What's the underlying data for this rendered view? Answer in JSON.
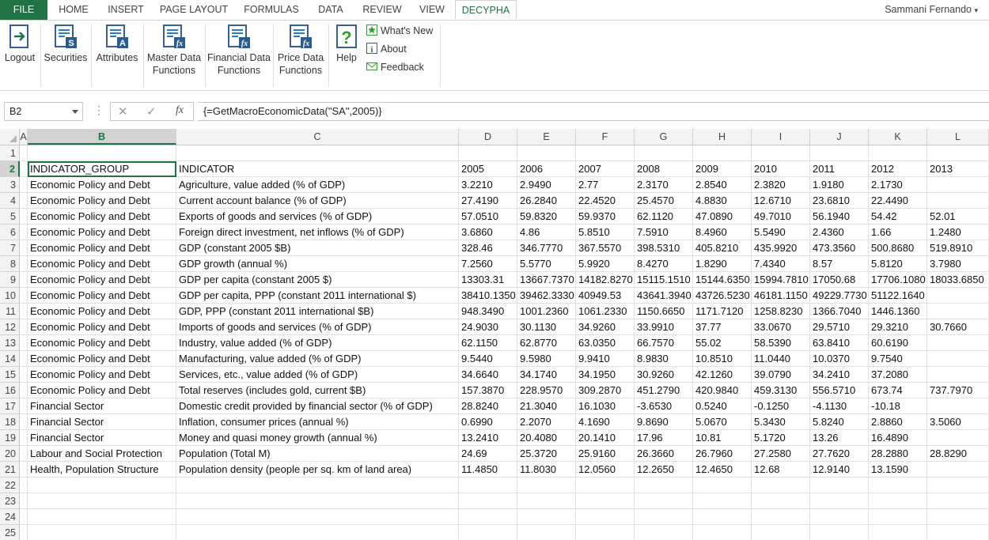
{
  "tabs": [
    "FILE",
    "HOME",
    "INSERT",
    "PAGE LAYOUT",
    "FORMULAS",
    "DATA",
    "REVIEW",
    "VIEW",
    "DECYPHA"
  ],
  "active_tab": "DECYPHA",
  "user_name": "Sammani Fernando",
  "ribbon": {
    "logout": "Logout",
    "securities": "Securities",
    "attributes": "Attributes",
    "master_data_1": "Master Data",
    "master_data_2": "Functions",
    "financial_data_1": "Financial Data",
    "financial_data_2": "Functions",
    "price_data_1": "Price Data",
    "price_data_2": "Functions",
    "help": "Help",
    "whats_new": "What's New",
    "about": "About",
    "feedback": "Feedback"
  },
  "formula_bar": {
    "name_box": "B2",
    "formula": "{=GetMacroEconomicData(\"SA\",2005)}"
  },
  "colors": {
    "accent": "#217346",
    "file_tab": "#217346"
  },
  "columns": [
    "A",
    "B",
    "C",
    "D",
    "E",
    "F",
    "G",
    "H",
    "I",
    "J",
    "K",
    "L"
  ],
  "selected_column": "B",
  "selected_row": "2",
  "row_numbers": [
    "1",
    "2",
    "3",
    "4",
    "5",
    "6",
    "7",
    "8",
    "9",
    "10",
    "11",
    "12",
    "13",
    "14",
    "15",
    "16",
    "17",
    "18",
    "19",
    "20",
    "21",
    "22",
    "23",
    "24",
    "25"
  ],
  "rows": [
    [
      "",
      "",
      "",
      "",
      "",
      "",
      "",
      "",
      "",
      "",
      "",
      ""
    ],
    [
      "",
      "INDICATOR_GROUP",
      "INDICATOR",
      "2005",
      "2006",
      "2007",
      "2008",
      "2009",
      "2010",
      "2011",
      "2012",
      "2013"
    ],
    [
      "",
      "Economic Policy and Debt",
      "Agriculture, value added (% of GDP)",
      "3.2210",
      "2.9490",
      "2.77",
      "2.3170",
      "2.8540",
      "2.3820",
      "1.9180",
      "2.1730",
      ""
    ],
    [
      "",
      "Economic Policy and Debt",
      "Current account balance (% of GDP)",
      "27.4190",
      "26.2840",
      "22.4520",
      "25.4570",
      "4.8830",
      "12.6710",
      "23.6810",
      "22.4490",
      ""
    ],
    [
      "",
      "Economic Policy and Debt",
      "Exports of goods and services (% of GDP)",
      "57.0510",
      "59.8320",
      "59.9370",
      "62.1120",
      "47.0890",
      "49.7010",
      "56.1940",
      "54.42",
      "52.01"
    ],
    [
      "",
      "Economic Policy and Debt",
      "Foreign direct investment, net inflows (% of GDP)",
      "3.6860",
      "4.86",
      "5.8510",
      "7.5910",
      "8.4960",
      "5.5490",
      "2.4360",
      "1.66",
      "1.2480"
    ],
    [
      "",
      "Economic Policy and Debt",
      "GDP (constant 2005 $B)",
      "328.46",
      "346.7770",
      "367.5570",
      "398.5310",
      "405.8210",
      "435.9920",
      "473.3560",
      "500.8680",
      "519.8910"
    ],
    [
      "",
      "Economic Policy and Debt",
      "GDP growth (annual %)",
      "7.2560",
      "5.5770",
      "5.9920",
      "8.4270",
      "1.8290",
      "7.4340",
      "8.57",
      "5.8120",
      "3.7980"
    ],
    [
      "",
      "Economic Policy and Debt",
      "GDP per capita (constant 2005 $)",
      "13303.31",
      "13667.7370",
      "14182.8270",
      "15115.1510",
      "15144.6350",
      "15994.7810",
      "17050.68",
      "17706.1080",
      "18033.6850"
    ],
    [
      "",
      "Economic Policy and Debt",
      "GDP per capita, PPP (constant 2011 international $)",
      "38410.1350",
      "39462.3330",
      "40949.53",
      "43641.3940",
      "43726.5230",
      "46181.1150",
      "49229.7730",
      "51122.1640",
      ""
    ],
    [
      "",
      "Economic Policy and Debt",
      "GDP, PPP (constant 2011 international $B)",
      "948.3490",
      "1001.2360",
      "1061.2330",
      "1150.6650",
      "1171.7120",
      "1258.8230",
      "1366.7040",
      "1446.1360",
      ""
    ],
    [
      "",
      "Economic Policy and Debt",
      "Imports of goods and services (% of GDP)",
      "24.9030",
      "30.1130",
      "34.9260",
      "33.9910",
      "37.77",
      "33.0670",
      "29.5710",
      "29.3210",
      "30.7660"
    ],
    [
      "",
      "Economic Policy and Debt",
      "Industry, value added (% of GDP)",
      "62.1150",
      "62.8770",
      "63.0350",
      "66.7570",
      "55.02",
      "58.5390",
      "63.8410",
      "60.6190",
      ""
    ],
    [
      "",
      "Economic Policy and Debt",
      "Manufacturing, value added (% of GDP)",
      "9.5440",
      "9.5980",
      "9.9410",
      "8.9830",
      "10.8510",
      "11.0440",
      "10.0370",
      "9.7540",
      ""
    ],
    [
      "",
      "Economic Policy and Debt",
      "Services, etc., value added (% of GDP)",
      "34.6640",
      "34.1740",
      "34.1950",
      "30.9260",
      "42.1260",
      "39.0790",
      "34.2410",
      "37.2080",
      ""
    ],
    [
      "",
      "Economic Policy and Debt",
      "Total reserves (includes gold, current $B)",
      "157.3870",
      "228.9570",
      "309.2870",
      "451.2790",
      "420.9840",
      "459.3130",
      "556.5710",
      "673.74",
      "737.7970"
    ],
    [
      "",
      "Financial Sector",
      "Domestic credit provided by financial sector (% of GDP)",
      "28.8240",
      "21.3040",
      "16.1030",
      "-3.6530",
      "0.5240",
      "-0.1250",
      "-4.1130",
      "-10.18",
      ""
    ],
    [
      "",
      "Financial Sector",
      "Inflation, consumer prices (annual %)",
      "0.6990",
      "2.2070",
      "4.1690",
      "9.8690",
      "5.0670",
      "5.3430",
      "5.8240",
      "2.8860",
      "3.5060"
    ],
    [
      "",
      "Financial Sector",
      "Money and quasi money growth (annual %)",
      "13.2410",
      "20.4080",
      "20.1410",
      "17.96",
      "10.81",
      "5.1720",
      "13.26",
      "16.4890",
      ""
    ],
    [
      "",
      "Labour and Social Protection",
      "Population (Total M)",
      "24.69",
      "25.3720",
      "25.9160",
      "26.3660",
      "26.7960",
      "27.2580",
      "27.7620",
      "28.2880",
      "28.8290"
    ],
    [
      "",
      "Health, Population Structure",
      "Population density (people per sq. km of land area)",
      "11.4850",
      "11.8030",
      "12.0560",
      "12.2650",
      "12.4650",
      "12.68",
      "12.9140",
      "13.1590",
      ""
    ],
    [
      "",
      "",
      "",
      "",
      "",
      "",
      "",
      "",
      "",
      "",
      "",
      ""
    ],
    [
      "",
      "",
      "",
      "",
      "",
      "",
      "",
      "",
      "",
      "",
      "",
      ""
    ],
    [
      "",
      "",
      "",
      "",
      "",
      "",
      "",
      "",
      "",
      "",
      "",
      ""
    ],
    [
      "",
      "",
      "",
      "",
      "",
      "",
      "",
      "",
      "",
      "",
      "",
      ""
    ]
  ]
}
